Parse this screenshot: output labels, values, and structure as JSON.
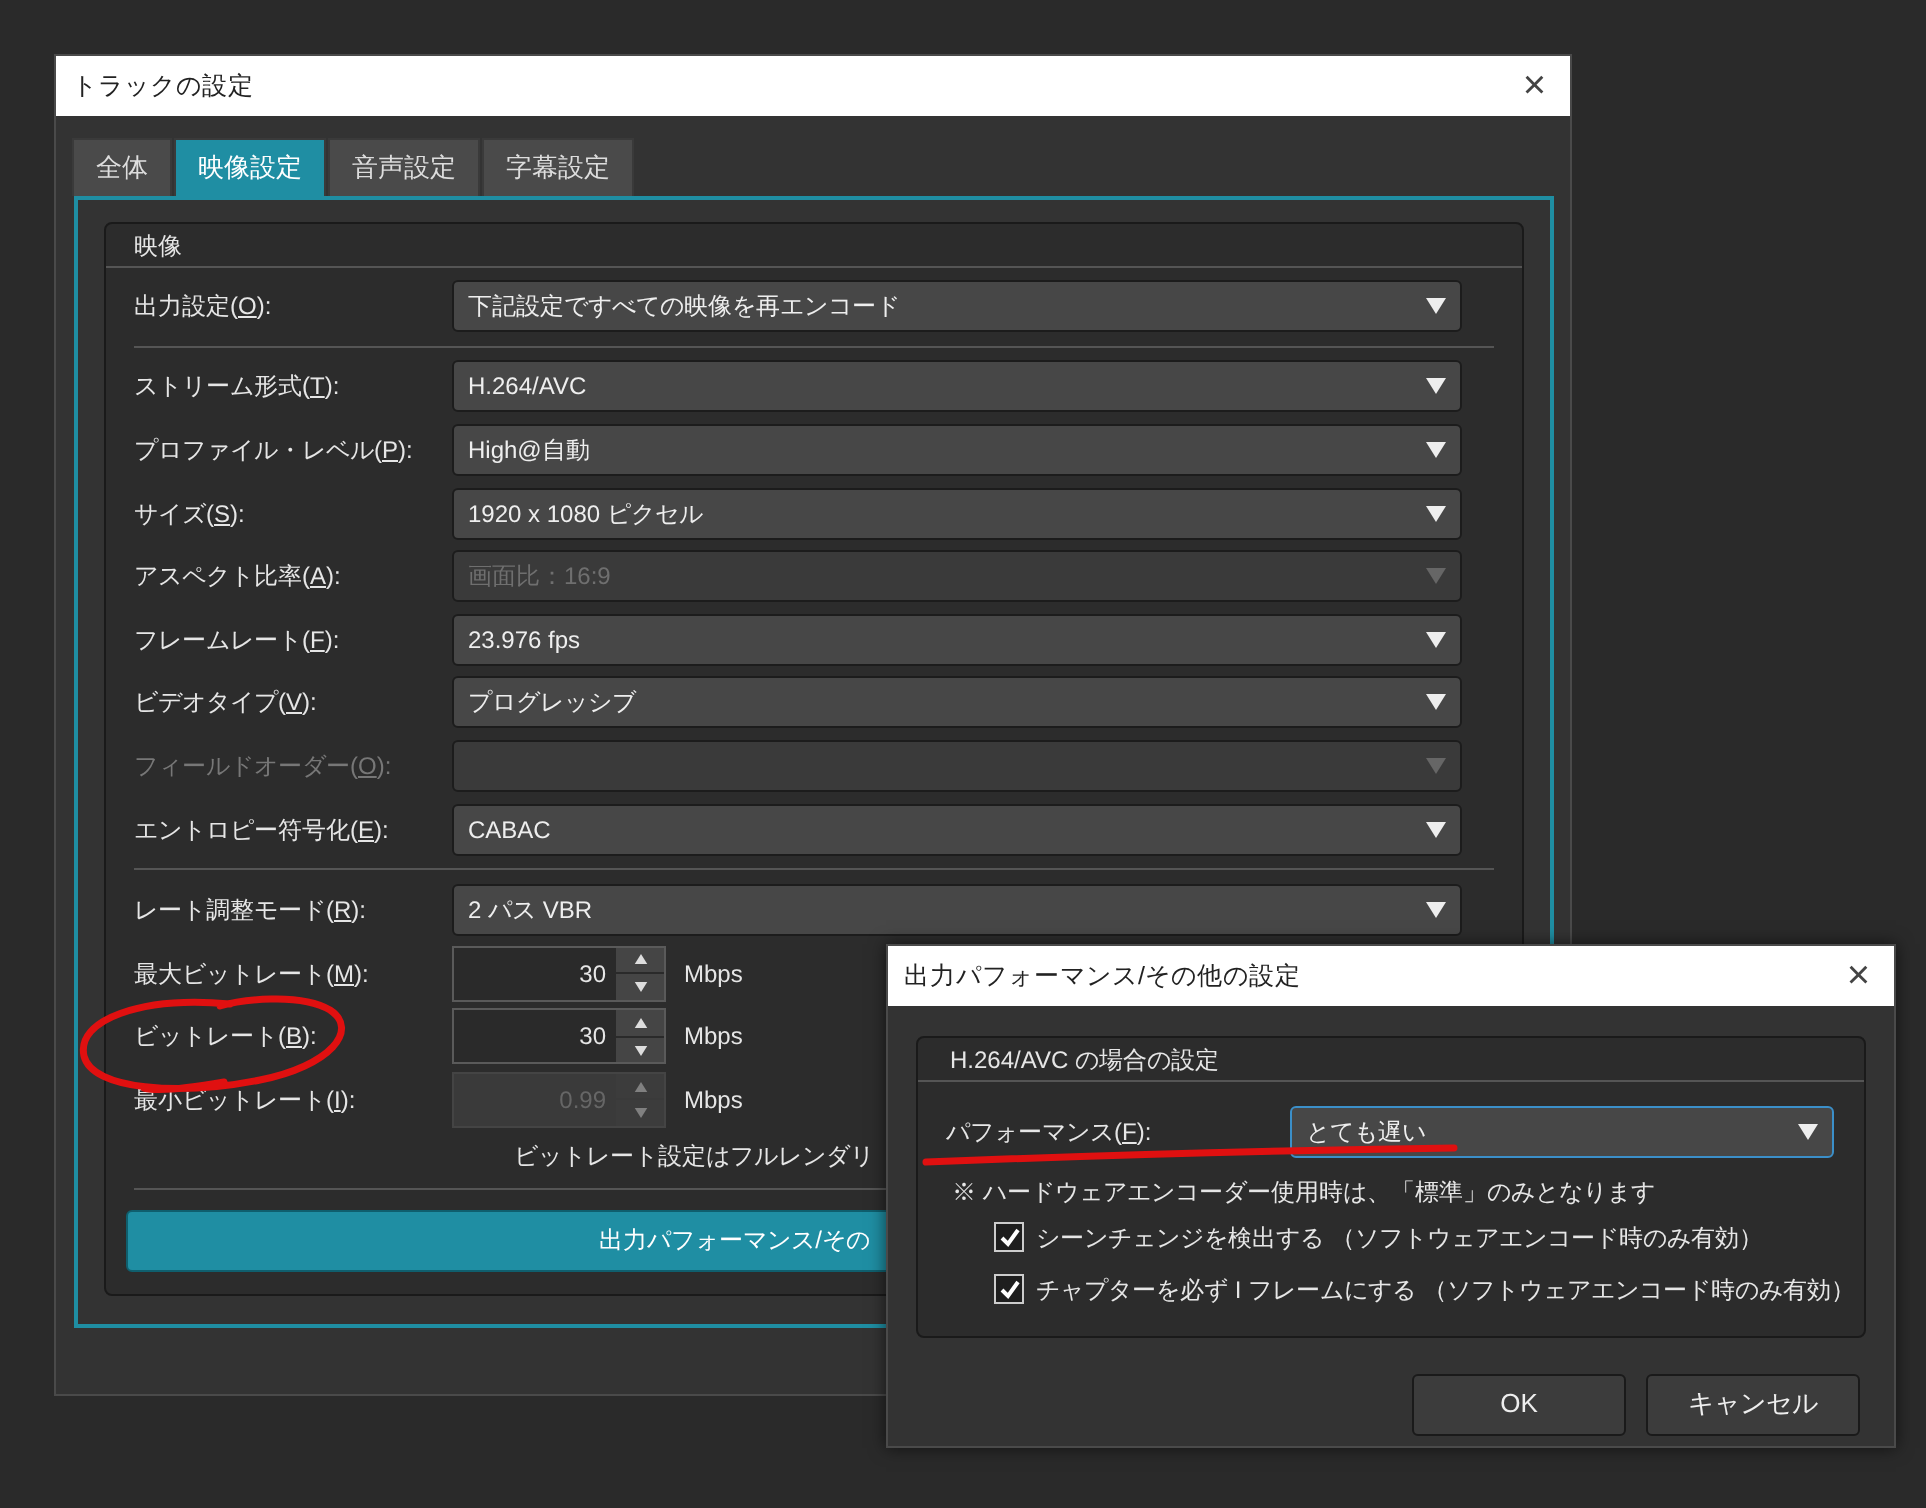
{
  "main_dialog": {
    "title": "トラックの設定",
    "close": "×",
    "tabs": [
      {
        "label": "全体",
        "selected": false
      },
      {
        "label": "映像設定",
        "selected": true
      },
      {
        "label": "音声設定",
        "selected": false
      },
      {
        "label": "字幕設定",
        "selected": false
      }
    ],
    "group": {
      "title": "映像",
      "sections": [
        [
          {
            "kind": "select",
            "label": "出力設定(O):",
            "value": "下記設定ですべての映像を再エンコード",
            "disabled": false,
            "label_disabled": false
          }
        ],
        [
          {
            "kind": "select",
            "label": "ストリーム形式(T):",
            "value": "H.264/AVC",
            "disabled": false,
            "label_disabled": false
          },
          {
            "kind": "select",
            "label": "プロファイル・レベル(P):",
            "value": "High@自動",
            "disabled": false,
            "label_disabled": false
          },
          {
            "kind": "select",
            "label": "サイズ(S):",
            "value": "1920 x 1080 ピクセル",
            "disabled": false,
            "label_disabled": false
          },
          {
            "kind": "select",
            "label": "アスペクト比率(A):",
            "value": "画面比：16:9",
            "disabled": true,
            "label_disabled": false
          },
          {
            "kind": "select",
            "label": "フレームレート(F):",
            "value": "23.976 fps",
            "disabled": false,
            "label_disabled": false
          },
          {
            "kind": "select",
            "label": "ビデオタイプ(V):",
            "value": "プログレッシブ",
            "disabled": false,
            "label_disabled": false
          },
          {
            "kind": "select",
            "label": "フィールドオーダー(O):",
            "disabled": true,
            "label_disabled": true
          },
          {
            "kind": "select",
            "label": "エントロピー符号化(E):",
            "value": "CABAC",
            "disabled": false,
            "label_disabled": false
          }
        ],
        [
          {
            "kind": "select",
            "label": "レート調整モード(R):",
            "value": "2 パス VBR",
            "disabled": false,
            "label_disabled": false
          },
          {
            "kind": "spin",
            "label": "最大ビットレート(M):",
            "value": "30",
            "unit": "Mbps",
            "disabled": false
          },
          {
            "kind": "spin",
            "label": "ビットレート(B):",
            "value": "30",
            "unit": "Mbps",
            "disabled": false
          },
          {
            "kind": "spin",
            "label": "最小ビットレート(I):",
            "value": "0.99",
            "unit": "Mbps",
            "disabled": true
          },
          {
            "kind": "note",
            "text": "ビットレート設定はフルレンダリ"
          }
        ]
      ]
    },
    "action_button": {
      "label": "出力パフォーマンス/その"
    }
  },
  "sub_dialog": {
    "title": "出力パフォーマンス/その他の設定",
    "close": "×",
    "group": {
      "title": "H.264/AVC の場合の設定",
      "select": {
        "label": "パフォーマンス(F):",
        "value": "とても遅い",
        "focused": true
      },
      "note": "※ ハードウェアエンコーダー使用時は、「標準」のみとなります",
      "checkboxes": [
        {
          "label": "シーンチェンジを検出する （ソフトウェアエンコード時のみ有効）",
          "checked": true
        },
        {
          "label": "チャプターを必ず I フレームにする （ソフトウェアエンコード時のみ有効）",
          "checked": true
        }
      ]
    },
    "buttons": [
      {
        "label": "OK"
      },
      {
        "label": "キャンセル"
      }
    ]
  }
}
